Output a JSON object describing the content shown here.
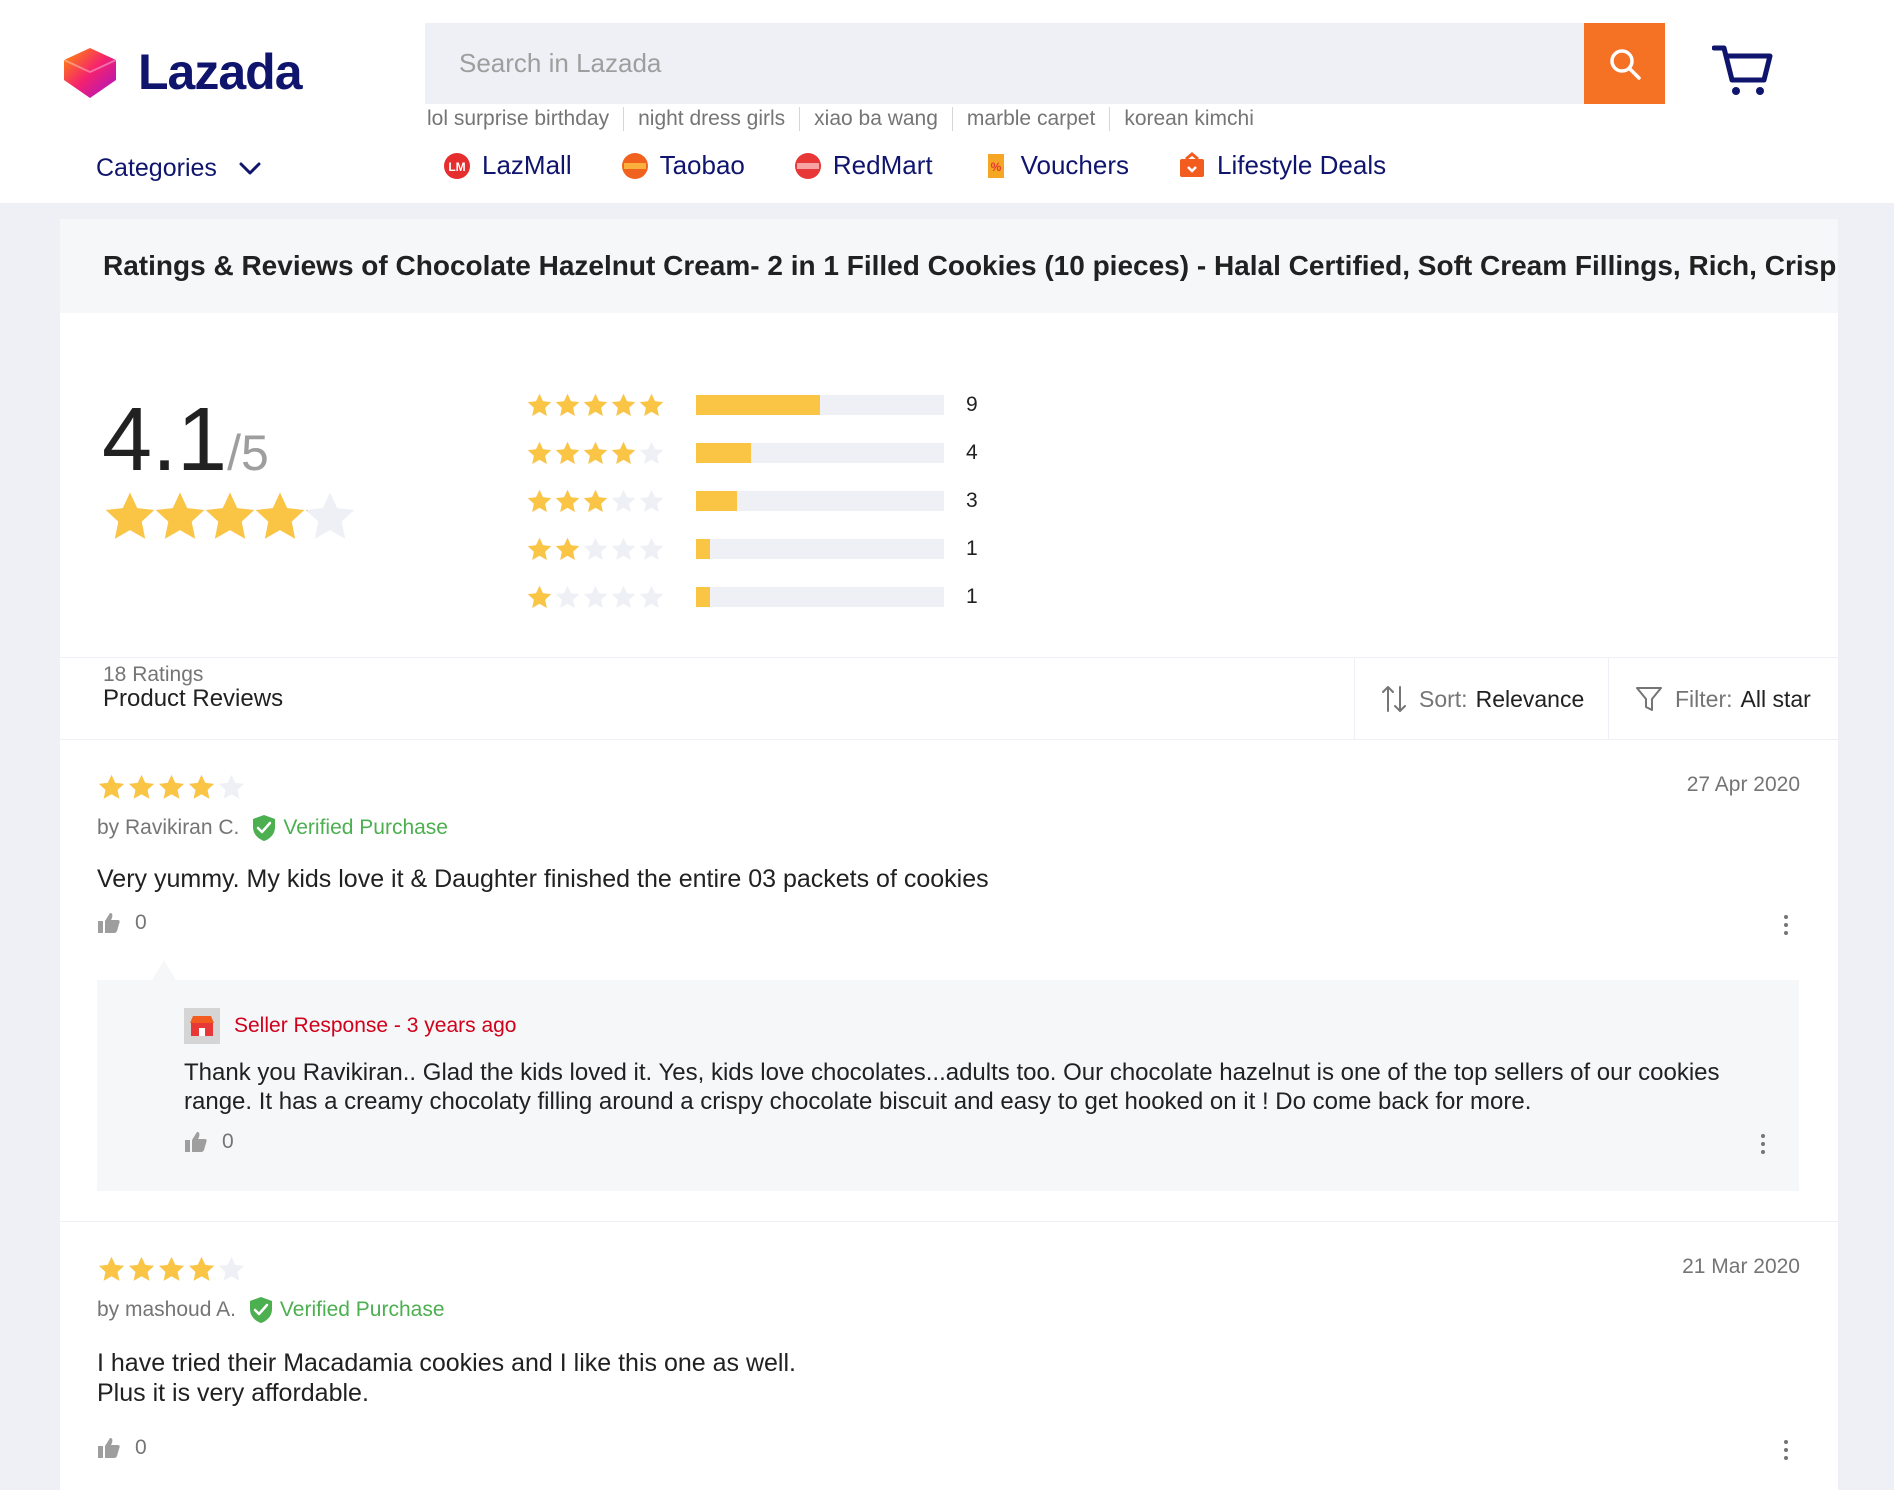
{
  "brand": {
    "name": "Lazada"
  },
  "search": {
    "placeholder": "Search in Lazada"
  },
  "suggestions": [
    "lol surprise birthday",
    "night dress girls",
    "xiao ba wang",
    "marble carpet",
    "korean kimchi"
  ],
  "categories": {
    "label": "Categories"
  },
  "nav": [
    {
      "label": "LazMall",
      "icon": "lazmall-icon",
      "color": "#e62e2e"
    },
    {
      "label": "Taobao",
      "icon": "taobao-icon",
      "color": "#f2621f"
    },
    {
      "label": "RedMart",
      "icon": "redmart-icon",
      "color": "#e83737"
    },
    {
      "label": "Vouchers",
      "icon": "voucher-icon",
      "color": "#f5a623"
    },
    {
      "label": "Lifestyle Deals",
      "icon": "lifestyle-icon",
      "color": "#f25c1f"
    }
  ],
  "page": {
    "title": "Ratings & Reviews of Chocolate Hazelnut Cream- 2 in 1 Filled Cookies (10 pieces) - Halal Certified, Soft Cream Fillings, Rich, Crisp..."
  },
  "summary": {
    "average": "4.1",
    "out_of": "/5",
    "average_value": 4.1,
    "ratings_label": "18 Ratings",
    "distribution": [
      {
        "stars": 5,
        "count": "9",
        "value": 9
      },
      {
        "stars": 4,
        "count": "4",
        "value": 4
      },
      {
        "stars": 3,
        "count": "3",
        "value": 3
      },
      {
        "stars": 2,
        "count": "1",
        "value": 1
      },
      {
        "stars": 1,
        "count": "1",
        "value": 1
      }
    ]
  },
  "reviews_section": {
    "title": "Product Reviews",
    "sort_label": "Sort:",
    "sort_value": "Relevance",
    "filter_label": "Filter:",
    "filter_value": "All star"
  },
  "reviews": [
    {
      "rating": 4,
      "date": "27 Apr 2020",
      "author": "by Ravikiran C.",
      "verified": "Verified Purchase",
      "text": "Very yummy. My kids love it & Daughter finished the entire 03 packets of cookies",
      "likes": "0",
      "seller_response": {
        "header": "Seller Response - 3 years ago",
        "text": "Thank you Ravikiran..  Glad the kids loved it.  Yes, kids love chocolates...adults too.  Our chocolate hazelnut is one of the top sellers of our cookies range.  It has a creamy chocolaty filling around a crispy chocolate biscuit and easy to get hooked on it !  Do come back for more.",
        "likes": "0"
      }
    },
    {
      "rating": 4,
      "date": "21 Mar 2020",
      "author": "by mashoud A.",
      "verified": "Verified Purchase",
      "text_line1": "I have tried their Macadamia cookies and I like this one as well.",
      "text_line2": "Plus it is very affordable.",
      "likes": "0"
    }
  ],
  "colors": {
    "star": "#fac445",
    "star_empty": "#eff0f5",
    "accent": "#f57224",
    "brand_text": "#0f146d",
    "verified": "#4caf50",
    "seller": "#d0011b"
  }
}
